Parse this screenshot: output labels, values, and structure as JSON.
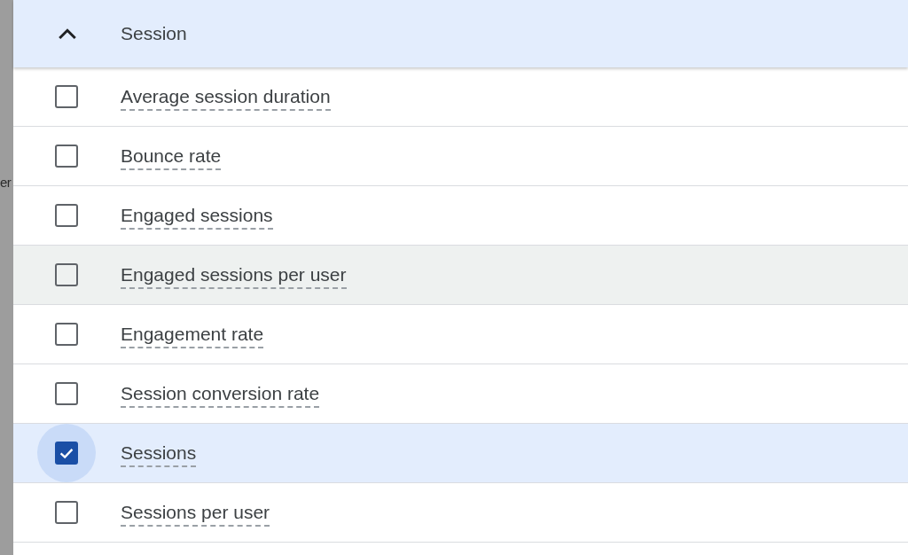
{
  "backdrop": {
    "text": "er"
  },
  "group": {
    "title": "Session",
    "expanded": true
  },
  "items": [
    {
      "label": "Average session duration",
      "checked": false,
      "hovered": false
    },
    {
      "label": "Bounce rate",
      "checked": false,
      "hovered": false
    },
    {
      "label": "Engaged sessions",
      "checked": false,
      "hovered": false
    },
    {
      "label": "Engaged sessions per user",
      "checked": false,
      "hovered": true
    },
    {
      "label": "Engagement rate",
      "checked": false,
      "hovered": false
    },
    {
      "label": "Session conversion rate",
      "checked": false,
      "hovered": false
    },
    {
      "label": "Sessions",
      "checked": true,
      "hovered": false
    },
    {
      "label": "Sessions per user",
      "checked": false,
      "hovered": false
    }
  ]
}
